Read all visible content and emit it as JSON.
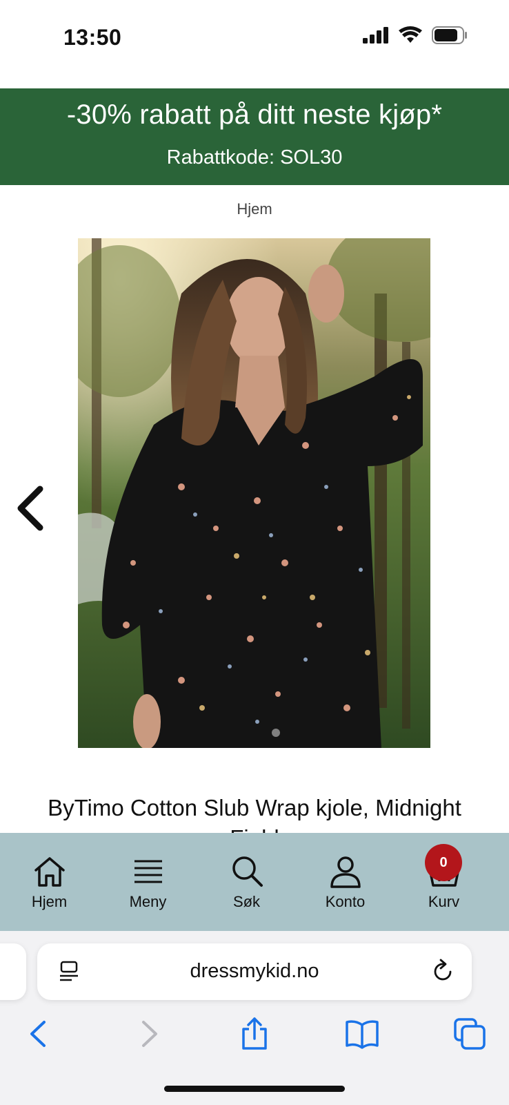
{
  "status_bar": {
    "time": "13:50"
  },
  "promo": {
    "headline": "-30% rabatt på ditt neste kjøp*",
    "code_line": "Rabattkode: SOL30",
    "color": "#2a6438"
  },
  "breadcrumb": {
    "home": "Hjem"
  },
  "product": {
    "title": "ByTimo Cotton Slub Wrap kjole, Midnight Field",
    "image_alt": "Model wearing dark floral long-sleeve wrap dress in forest setting"
  },
  "site_nav": {
    "background": "#a9c3c8",
    "items": [
      {
        "label": "Hjem",
        "icon": "home-icon"
      },
      {
        "label": "Meny",
        "icon": "menu-icon"
      },
      {
        "label": "Søk",
        "icon": "search-icon"
      },
      {
        "label": "Konto",
        "icon": "account-icon"
      },
      {
        "label": "Kurv",
        "icon": "basket-icon"
      }
    ],
    "cart_count": "0",
    "badge_color": "#b3161b"
  },
  "browser": {
    "url": "dressmykid.no",
    "accent": "#1a73e8"
  }
}
